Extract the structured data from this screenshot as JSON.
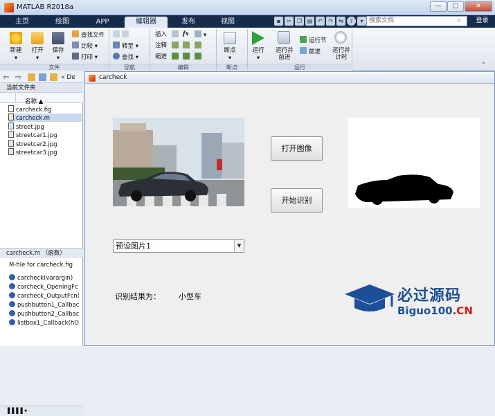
{
  "window": {
    "title": "MATLAB R2018a",
    "controls": [
      "—",
      "□",
      "✕"
    ]
  },
  "tabs": [
    {
      "label": "主页",
      "active": false
    },
    {
      "label": "绘图",
      "active": false
    },
    {
      "label": "APP",
      "active": false
    },
    {
      "label": "编辑器",
      "active": true
    },
    {
      "label": "发布",
      "active": false
    },
    {
      "label": "视图",
      "active": false
    }
  ],
  "search": {
    "placeholder": "搜索文档",
    "login_label": "登录"
  },
  "ribbon": {
    "file": {
      "new": "新建",
      "open": "打开",
      "save": "保存",
      "find_files": "查找文件",
      "compare": "比较",
      "print": "打印",
      "group": "文件"
    },
    "navigate": {
      "goto": "转至",
      "find": "查找",
      "group": "导航"
    },
    "edit": {
      "insert": "插入",
      "comment": "注释",
      "indent": "缩进",
      "fx": "fx",
      "group": "编辑"
    },
    "breakpoints": {
      "label": "断点",
      "group": "断点"
    },
    "run": {
      "run": "运行",
      "run_advance": "运行并\n前进",
      "run_section": "运行节",
      "advance": "前进",
      "run_time": "运行并\n计时",
      "group": "运行"
    }
  },
  "left": {
    "current_folder": "当前文件夹",
    "path_arrow": "« De",
    "name_header": "名称 ▲",
    "files": [
      "carcheck.fig",
      "carcheck.m",
      "street.jpg",
      "streetcar1.jpg",
      "streetcar2.jpg",
      "streetcar3.jpg"
    ],
    "selected": "carcheck.m",
    "detail_header": "carcheck.m （函数）",
    "detail_desc": "M-file for carcheck.fig",
    "functions": [
      "carcheck(varargin)",
      "carcheck_OpeningFc",
      "carcheck_OutputFcn(",
      "pushbutton1_Callbac",
      "pushbutton2_Callbac",
      "listbox1_Callback(hO"
    ]
  },
  "figure": {
    "title": "carcheck",
    "open_button": "打开图像",
    "recognize_button": "开始识别",
    "popup_value": "预设图片1",
    "result_label": "识别结果为：",
    "result_value": "小型车"
  },
  "watermark": {
    "cn": "必过源码",
    "en": "Biguo100",
    "suffix": ".CN"
  },
  "colors": {
    "accent": "#1d4f98",
    "tabbar": "#152c4a",
    "car_body": "#2b2f36"
  }
}
